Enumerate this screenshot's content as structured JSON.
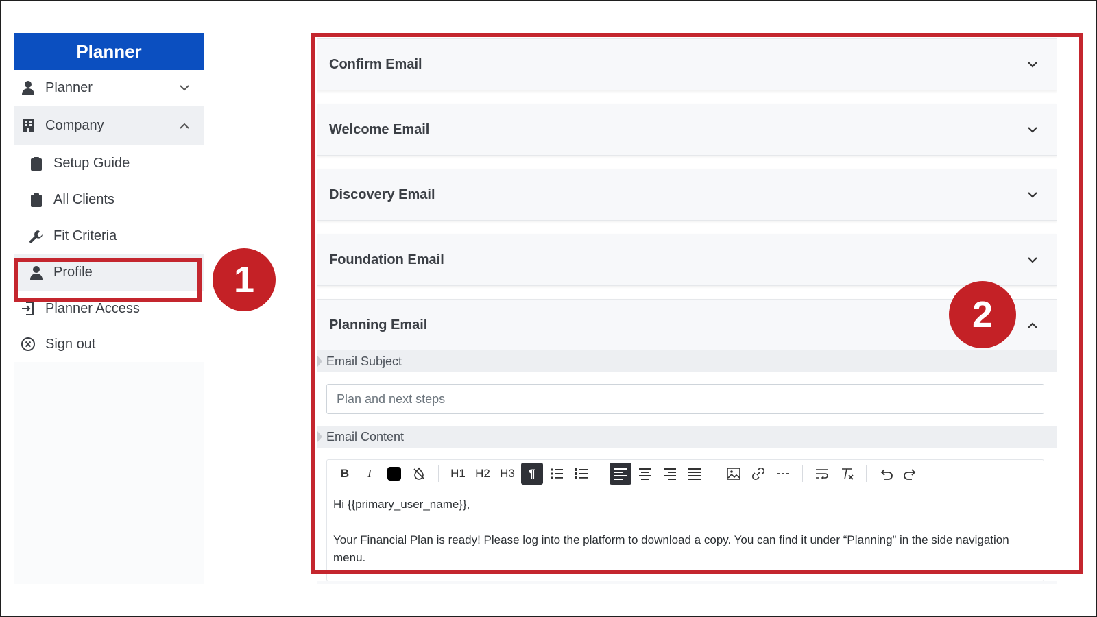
{
  "sidebar": {
    "brand": "Planner",
    "items": [
      {
        "label": "Planner"
      },
      {
        "label": "Company"
      },
      {
        "label": "Setup Guide"
      },
      {
        "label": "All Clients"
      },
      {
        "label": "Fit Criteria"
      },
      {
        "label": "Profile"
      },
      {
        "label": "Planner Access"
      },
      {
        "label": "Sign out"
      }
    ]
  },
  "callouts": {
    "first": "1",
    "second": "2"
  },
  "accordion": {
    "items": [
      {
        "title": "Confirm Email"
      },
      {
        "title": "Welcome Email"
      },
      {
        "title": "Discovery Email"
      },
      {
        "title": "Foundation Email"
      },
      {
        "title": "Planning Email"
      }
    ],
    "planning": {
      "subject_label": "Email Subject",
      "subject_value": "Plan and next steps",
      "content_label": "Email Content",
      "toolbar": {
        "h1": "H1",
        "h2": "H2",
        "h3": "H3"
      },
      "content_lines": [
        "Hi {{primary_user_name}},",
        "Your Financial Plan is ready! Please log into the platform to download a copy. You can find it under “Planning” in the side navigation menu."
      ]
    }
  },
  "colors": {
    "brand": "#0b4fc0",
    "callout": "#c4262e"
  }
}
